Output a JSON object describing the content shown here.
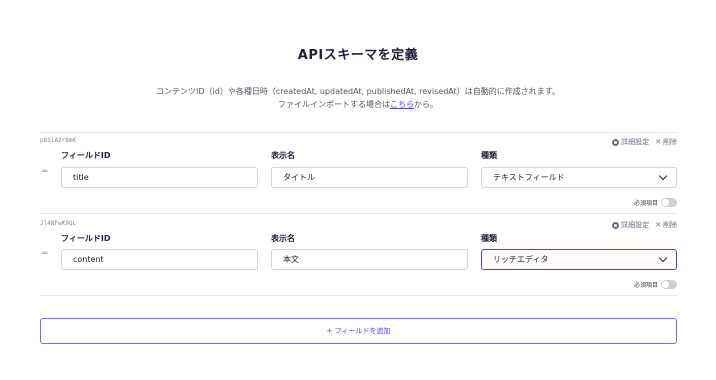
{
  "page": {
    "title": "APIスキーマを定義",
    "description_line1": "コンテンツID（id）や各種日時（createdAt, updatedAt, publishedAt, revisedAt）は自動的に作成されます。",
    "description_line2_prefix": "ファイルインポートする場合は",
    "description_link": "こちら",
    "description_line2_suffix": "から。"
  },
  "labels": {
    "field_id": "フィールドID",
    "display_name": "表示名",
    "type": "種類",
    "advanced": "詳細設定",
    "delete": "削除",
    "required": "必須項目"
  },
  "fields": [
    {
      "uid": "pbSiA2r8mK",
      "field_id": "title",
      "display_name": "タイトル",
      "type": "テキストフィールド"
    },
    {
      "uid": "Jl4NFwK9QL",
      "field_id": "content",
      "display_name": "本文",
      "type": "リッチエディタ"
    }
  ],
  "add_button": "+ フィールドを追加",
  "colors": {
    "accent": "#563bff"
  }
}
